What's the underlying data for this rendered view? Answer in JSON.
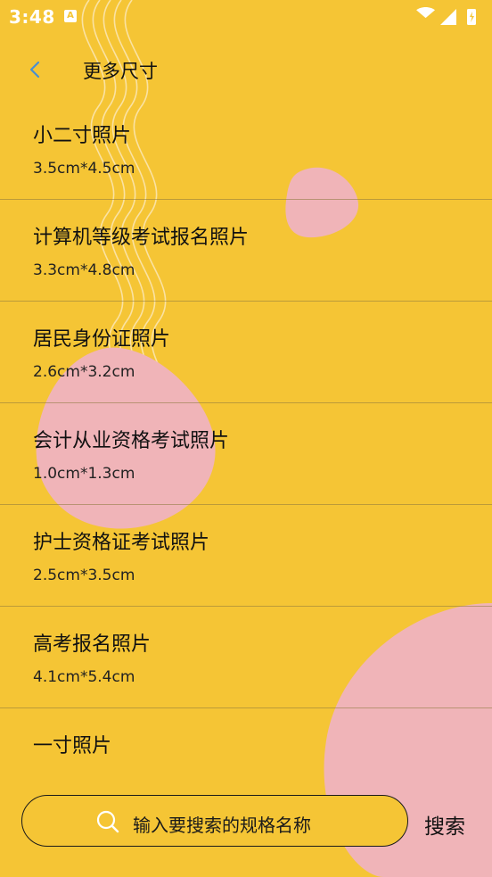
{
  "status_bar": {
    "time": "3:48",
    "notification_glyph": "A"
  },
  "header": {
    "title": "更多尺寸"
  },
  "list": [
    {
      "name": "小二寸照片",
      "size": "3.5cm*4.5cm"
    },
    {
      "name": "计算机等级考试报名照片",
      "size": "3.3cm*4.8cm"
    },
    {
      "name": "居民身份证照片",
      "size": "2.6cm*3.2cm"
    },
    {
      "name": "会计从业资格考试照片",
      "size": "1.0cm*1.3cm"
    },
    {
      "name": "护士资格证考试照片",
      "size": "2.5cm*3.5cm"
    },
    {
      "name": "高考报名照片",
      "size": "4.1cm*5.4cm"
    },
    {
      "name": "一寸照片",
      "size": ""
    }
  ],
  "search": {
    "placeholder": "输入要搜索的规格名称",
    "button_label": "搜索"
  },
  "colors": {
    "background": "#F5C535",
    "blob": "#F0B4B8",
    "text": "#111111",
    "back_arrow": "#4A8FD0"
  },
  "icons": {
    "back": "chevron-left-icon",
    "search": "search-icon",
    "wifi": "wifi-icon",
    "signal": "signal-icon",
    "battery": "battery-icon"
  }
}
